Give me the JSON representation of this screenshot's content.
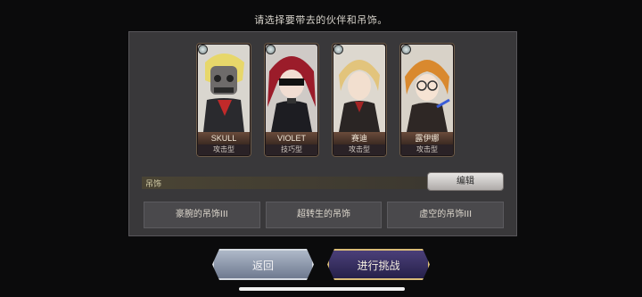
{
  "instruction": "请选择要带去的伙伴和吊饰。",
  "party": [
    {
      "name": "SKULL",
      "type": "攻击型",
      "portrait": "skull-masked-character"
    },
    {
      "name": "VIOLET",
      "type": "技巧型",
      "portrait": "red-hair-masked-character"
    },
    {
      "name": "赛迪",
      "type": "攻击型",
      "portrait": "blonde-character"
    },
    {
      "name": "露伊娜",
      "type": "攻击型",
      "portrait": "orange-hair-glasses-character"
    }
  ],
  "accessory": {
    "label": "吊饰",
    "edit_label": "编辑",
    "slots": [
      "豪腕的吊饰III",
      "超转生的吊饰",
      "虚空的吊饰III"
    ]
  },
  "buttons": {
    "back": "返回",
    "start": "进行挑战"
  },
  "colors": {
    "panel": "#39383a",
    "start_border": "#d8bb78",
    "start_fill": "#3a3163"
  }
}
